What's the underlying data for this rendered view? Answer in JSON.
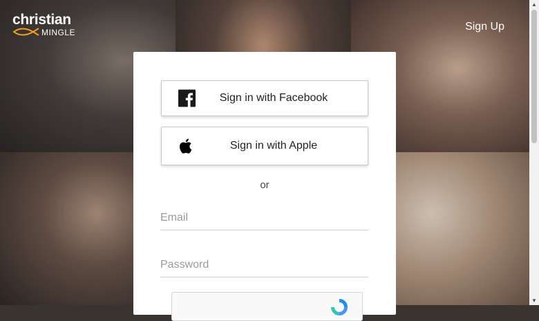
{
  "header": {
    "logo_word": "christian",
    "logo_sub": "MINGLE",
    "signup_label": "Sign Up"
  },
  "login": {
    "facebook_label": "Sign in with Facebook",
    "apple_label": "Sign in with Apple",
    "or_label": "or",
    "email_placeholder": "Email",
    "password_placeholder": "Password"
  },
  "colors": {
    "facebook_icon": "#1a1a1a",
    "text": "#222222",
    "card": "#ffffff"
  }
}
